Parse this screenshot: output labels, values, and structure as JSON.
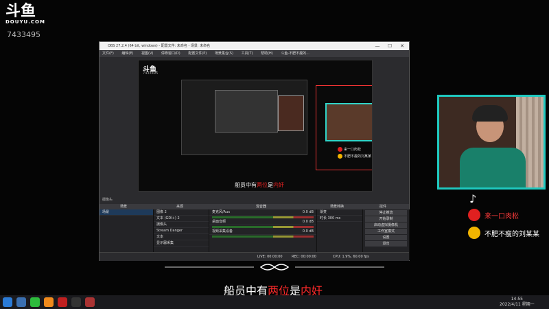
{
  "stream": {
    "logo": "斗鱼",
    "logo_sub": "DOUYU.COM",
    "room_id": "7433495"
  },
  "obs": {
    "title": "OBS 27.2.4 (64 bit, windows) - 配置文件: 未命名 - 场景: 未命名",
    "menu": [
      "文件(F)",
      "编辑(E)",
      "视图(V)",
      "停靠窗口(D)",
      "配置文件(P)",
      "场景集合(S)",
      "工具(T)",
      "帮助(H)",
      "斗鱼-不肥不瘦的..."
    ],
    "win_controls": [
      "—",
      "☐",
      "✕"
    ],
    "preview": {
      "logo": "斗鱼",
      "room_id": "7433495",
      "subtitle_pre": "船员中有",
      "subtitle_red1": "两位",
      "subtitle_mid": "是",
      "subtitle_red2": "内奸",
      "badge1": "来一口肉松",
      "badge2": "不肥不瘦的刘某某"
    },
    "scene_label": "摄像头",
    "docks": {
      "scenes_header": "场景",
      "sources_header": "来源",
      "mixer_header": "混音器",
      "transitions_header": "场景转换",
      "controls_header": "控件",
      "scenes": [
        "场景"
      ],
      "sources": [
        "图像 2",
        "文本 (GDI+) 2",
        "摄像头",
        "Stream Danger",
        "文本",
        "显示器采集"
      ],
      "mixer": [
        {
          "name": "麦克风/Aux",
          "db": "0.0 dB"
        },
        {
          "name": "桌面音频",
          "db": "0.0 dB"
        },
        {
          "name": "视频采集设备",
          "db": "0.0 dB"
        }
      ],
      "transition": "渐变",
      "duration_label": "时长",
      "duration": "300 ms",
      "controls": [
        "停止推流",
        "开始录制",
        "启动虚拟摄像机",
        "工作室模式",
        "设置",
        "退出"
      ]
    },
    "status": {
      "live": "LIVE: 00:00:00",
      "rec": "REC: 00:00:00",
      "cpu": "CPU: 1.9%, 60.00 fps"
    }
  },
  "overlay": {
    "social1": "来一口肉松",
    "social2": "不肥不瘦的刘某某",
    "subtitle_pre": "船员中有",
    "subtitle_red1": "两位",
    "subtitle_mid": "是",
    "subtitle_red2": "内奸"
  },
  "taskbar": {
    "time": "14:55",
    "date": "2022/4/11 星期一"
  },
  "colors": {
    "accent_teal": "#1fc9c0",
    "subtitle_red": "#ff2a2a",
    "selection_red": "#ee3333"
  }
}
